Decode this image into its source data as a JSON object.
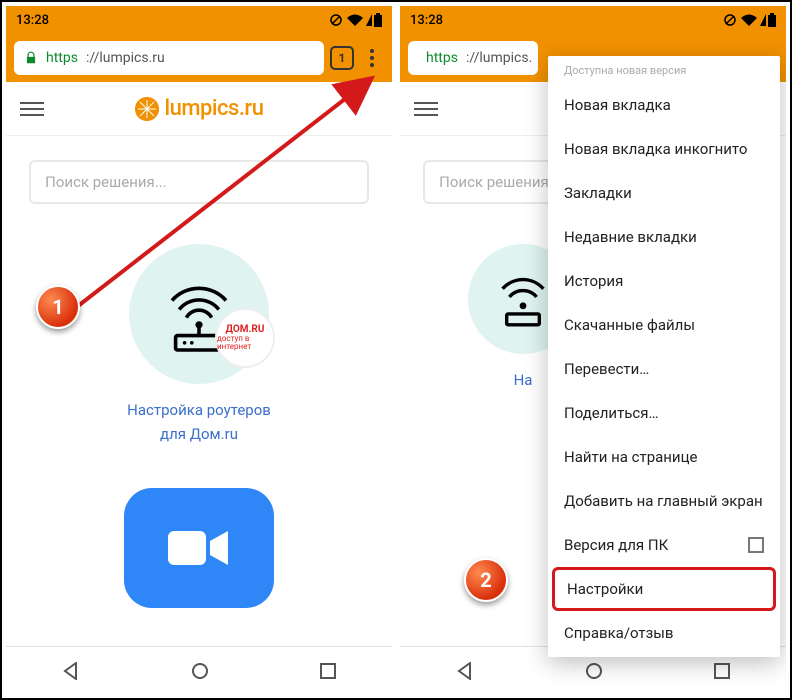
{
  "status": {
    "time": "13:28"
  },
  "addr": {
    "scheme": "https",
    "host": "://lumpics.ru",
    "host_short": "://lumpics.",
    "tabcount": "1"
  },
  "site": {
    "logo_text": "lumpics.ru",
    "search_placeholder": "Поиск решения...",
    "card_line1": "Настройка роутеров",
    "card_line2": "для Дом.ru",
    "dom_main": "ДОМ.RU",
    "dom_sub": "доступ в интернет"
  },
  "menu": {
    "header": "Доступна новая версия",
    "items": [
      "Новая вкладка",
      "Новая вкладка инкогнито",
      "Закладки",
      "Недавние вкладки",
      "История",
      "Скачанные файлы",
      "Перевести…",
      "Поделиться…",
      "Найти на странице",
      "Добавить на главный экран",
      "Версия для ПК",
      "Настройки",
      "Справка/отзыв"
    ]
  },
  "steps": {
    "one": "1",
    "two": "2"
  }
}
